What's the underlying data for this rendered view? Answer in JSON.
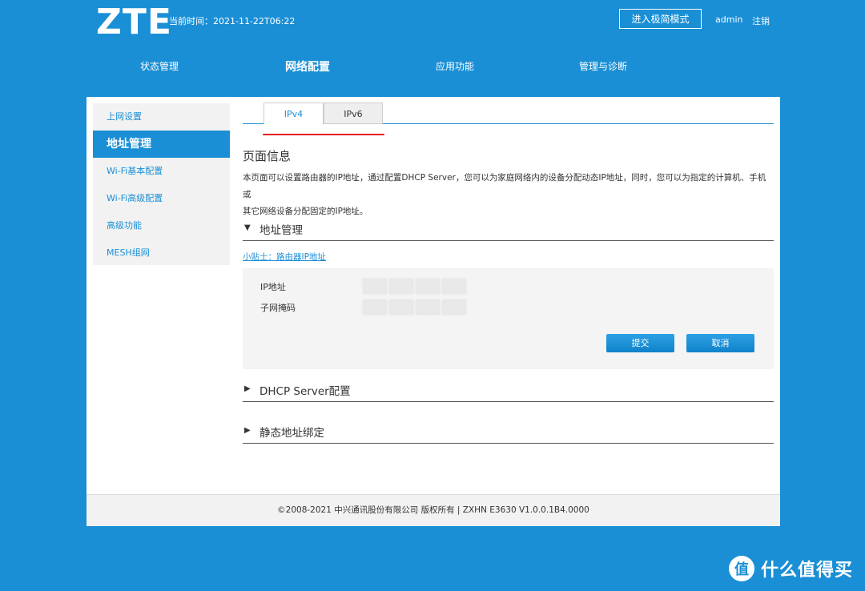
{
  "header": {
    "logo": "ZTE",
    "time_label": "当前时间：2021-11-22T06:22",
    "simple_mode_button": "进入极简模式",
    "username": "admin",
    "logout": "注销"
  },
  "top_nav": {
    "items": [
      {
        "label": "状态管理",
        "active": false
      },
      {
        "label": "网络配置",
        "active": true
      },
      {
        "label": "应用功能",
        "active": false
      },
      {
        "label": "管理与诊断",
        "active": false
      }
    ]
  },
  "sidebar": {
    "items": [
      {
        "label": "上网设置",
        "active": false
      },
      {
        "label": "地址管理",
        "active": true
      },
      {
        "label": "Wi-Fi基本配置",
        "active": false
      },
      {
        "label": "Wi-Fi高级配置",
        "active": false
      },
      {
        "label": "高级功能",
        "active": false
      },
      {
        "label": "MESH组网",
        "active": false
      }
    ]
  },
  "tabs": [
    {
      "label": "IPv4",
      "active": true
    },
    {
      "label": "IPv6",
      "active": false
    }
  ],
  "page_info": {
    "title": "页面信息",
    "line1": "本页面可以设置路由器的IP地址，通过配置DHCP Server，您可以为家庭网络内的设备分配动态IP地址，同时，您可以为指定的计算机、手机或",
    "line2": "其它网络设备分配固定的IP地址。"
  },
  "sections": {
    "address_mgmt": {
      "title": "地址管理",
      "expanded": true
    },
    "dhcp": {
      "title": "DHCP Server配置",
      "expanded": false
    },
    "static_bind": {
      "title": "静态地址绑定",
      "expanded": false
    }
  },
  "tip": "小贴士：路由器IP地址",
  "form": {
    "ip_label": "IP地址",
    "mask_label": "子网掩码",
    "submit": "提交",
    "cancel": "取消"
  },
  "footer": "©2008-2021 中兴通讯股份有限公司 版权所有  |   ZXHN E3630 V1.0.0.1B4.0000",
  "watermark": {
    "icon_text": "值",
    "text": "什么值得买"
  },
  "colors": {
    "background": "#1a8fd6",
    "accent": "#1a8fd6",
    "tab_underline": "#e02020",
    "button": "#1a8fd6"
  }
}
